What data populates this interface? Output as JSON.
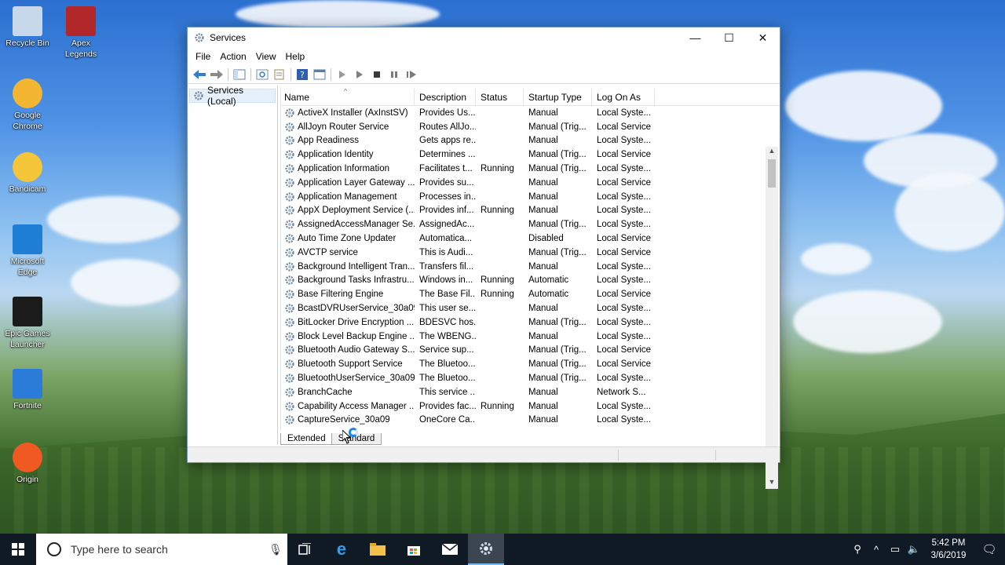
{
  "desktop": {
    "icons": [
      {
        "label": "Recycle Bin",
        "icon": "recycle-bin-icon",
        "color": "#c7d8ea"
      },
      {
        "label": "Apex Legends",
        "icon": "apex-legends-icon",
        "color": "#b2272a"
      },
      {
        "label": "Google Chrome",
        "icon": "chrome-icon",
        "color": "#f2b632"
      },
      {
        "label": "Bandicam",
        "icon": "smiley-icon",
        "color": "#f6c63a"
      },
      {
        "label": "Microsoft Edge",
        "icon": "edge-icon",
        "color": "#1f7fd6"
      },
      {
        "label": "Epic Games Launcher",
        "icon": "epic-games-icon",
        "color": "#1b1b1b"
      },
      {
        "label": "Fortnite",
        "icon": "fortnite-icon",
        "color": "#2b7bd9"
      },
      {
        "label": "Origin",
        "icon": "origin-icon",
        "color": "#f05a22"
      }
    ]
  },
  "window": {
    "title": "Services",
    "controls": {
      "minimize": "—",
      "maximize": "☐",
      "close": "✕"
    },
    "menu": [
      "File",
      "Action",
      "View",
      "Help"
    ],
    "tree": {
      "root": "Services (Local)"
    },
    "columns": [
      "Name",
      "Description",
      "Status",
      "Startup Type",
      "Log On As"
    ],
    "rows": [
      [
        "ActiveX Installer (AxInstSV)",
        "Provides Us...",
        "",
        "Manual",
        "Local Syste..."
      ],
      [
        "AllJoyn Router Service",
        "Routes AllJo...",
        "",
        "Manual (Trig...",
        "Local Service"
      ],
      [
        "App Readiness",
        "Gets apps re...",
        "",
        "Manual",
        "Local Syste..."
      ],
      [
        "Application Identity",
        "Determines ...",
        "",
        "Manual (Trig...",
        "Local Service"
      ],
      [
        "Application Information",
        "Facilitates t...",
        "Running",
        "Manual (Trig...",
        "Local Syste..."
      ],
      [
        "Application Layer Gateway ...",
        "Provides su...",
        "",
        "Manual",
        "Local Service"
      ],
      [
        "Application Management",
        "Processes in...",
        "",
        "Manual",
        "Local Syste..."
      ],
      [
        "AppX Deployment Service (...",
        "Provides inf...",
        "Running",
        "Manual",
        "Local Syste..."
      ],
      [
        "AssignedAccessManager Se...",
        "AssignedAc...",
        "",
        "Manual (Trig...",
        "Local Syste..."
      ],
      [
        "Auto Time Zone Updater",
        "Automatica...",
        "",
        "Disabled",
        "Local Service"
      ],
      [
        "AVCTP service",
        "This is Audi...",
        "",
        "Manual (Trig...",
        "Local Service"
      ],
      [
        "Background Intelligent Tran...",
        "Transfers fil...",
        "",
        "Manual",
        "Local Syste..."
      ],
      [
        "Background Tasks Infrastru...",
        "Windows in...",
        "Running",
        "Automatic",
        "Local Syste..."
      ],
      [
        "Base Filtering Engine",
        "The Base Fil...",
        "Running",
        "Automatic",
        "Local Service"
      ],
      [
        "BcastDVRUserService_30a09",
        "This user se...",
        "",
        "Manual",
        "Local Syste..."
      ],
      [
        "BitLocker Drive Encryption ...",
        "BDESVC hos...",
        "",
        "Manual (Trig...",
        "Local Syste..."
      ],
      [
        "Block Level Backup Engine ...",
        "The WBENG...",
        "",
        "Manual",
        "Local Syste..."
      ],
      [
        "Bluetooth Audio Gateway S...",
        "Service sup...",
        "",
        "Manual (Trig...",
        "Local Service"
      ],
      [
        "Bluetooth Support Service",
        "The Bluetoo...",
        "",
        "Manual (Trig...",
        "Local Service"
      ],
      [
        "BluetoothUserService_30a09",
        "The Bluetoo...",
        "",
        "Manual (Trig...",
        "Local Syste..."
      ],
      [
        "BranchCache",
        "This service ...",
        "",
        "Manual",
        "Network S..."
      ],
      [
        "Capability Access Manager ...",
        "Provides fac...",
        "Running",
        "Manual",
        "Local Syste..."
      ],
      [
        "CaptureService_30a09",
        "OneCore Ca...",
        "",
        "Manual",
        "Local Syste..."
      ]
    ],
    "tabs": [
      "Extended",
      "Standard"
    ]
  },
  "taskbar": {
    "search_placeholder": "Type here to search",
    "time": "5:42 PM",
    "date": "3/6/2019"
  }
}
